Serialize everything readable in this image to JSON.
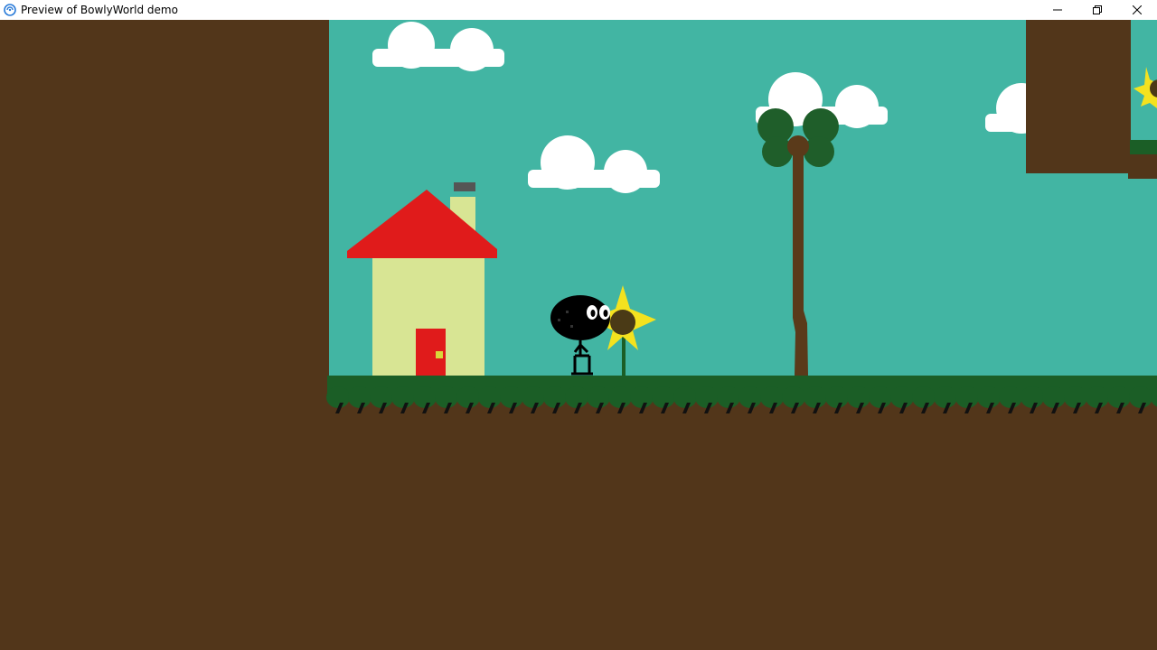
{
  "window": {
    "title": "Preview of BowlyWorld demo",
    "app_icon": "game-engine-icon",
    "controls": {
      "minimize_icon": "minimize-icon",
      "restore_icon": "restore-icon",
      "close_icon": "close-icon"
    }
  },
  "scene": {
    "colors": {
      "sky": "#42b5a3",
      "dirt": "#52361a",
      "grass": "#1b5e26",
      "cloud": "#ffffff",
      "house_wall": "#d8e594",
      "roof": "#e01b1b",
      "door": "#e01b1b",
      "door_knob": "#d8d83a",
      "chimney": "#d8e594",
      "chimney_cap": "#555555",
      "trunk": "#5a3a1a",
      "leaves": "#1f5e2a",
      "sunflower_petal": "#f4e21f",
      "sunflower_center": "#4a3a16",
      "player": "#000000",
      "player_eye": "#ffffff"
    },
    "objects": [
      "left-dirt-wall",
      "sky",
      "clouds",
      "house",
      "player-character",
      "sunflower",
      "palm-tree",
      "upper-right-dirt-block",
      "grass-ground",
      "underground-dirt"
    ]
  }
}
